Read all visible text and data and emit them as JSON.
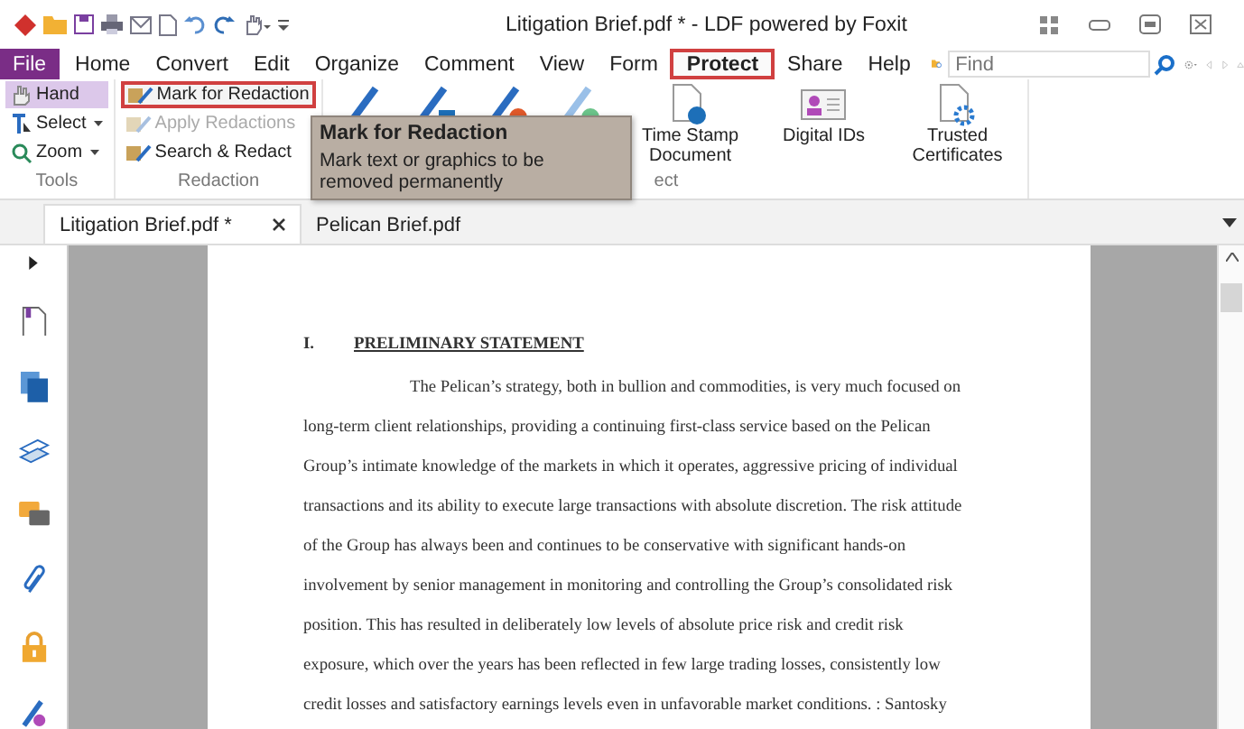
{
  "window": {
    "title": "Litigation Brief.pdf * - LDF powered by Foxit"
  },
  "menu": [
    {
      "label": "File",
      "kind": "file",
      "selected": false
    },
    {
      "label": "Home",
      "kind": "tab",
      "selected": false
    },
    {
      "label": "Convert",
      "kind": "tab",
      "selected": false
    },
    {
      "label": "Edit",
      "kind": "tab",
      "selected": false
    },
    {
      "label": "Organize",
      "kind": "tab",
      "selected": false
    },
    {
      "label": "Comment",
      "kind": "tab",
      "selected": false
    },
    {
      "label": "View",
      "kind": "tab",
      "selected": false
    },
    {
      "label": "Form",
      "kind": "tab",
      "selected": false
    },
    {
      "label": "Protect",
      "kind": "tab",
      "selected": true
    },
    {
      "label": "Share",
      "kind": "tab",
      "selected": false
    },
    {
      "label": "Help",
      "kind": "tab",
      "selected": false
    }
  ],
  "search": {
    "placeholder": "Find"
  },
  "ribbon": {
    "tools": {
      "label": "Tools",
      "items": [
        {
          "label": "Hand",
          "selected": true,
          "dropdown": false
        },
        {
          "label": "Select",
          "selected": false,
          "dropdown": true
        },
        {
          "label": "Zoom",
          "selected": false,
          "dropdown": true
        }
      ]
    },
    "redaction": {
      "label": "Redaction",
      "items": [
        {
          "label": "Mark for Redaction",
          "highlighted": true,
          "disabled": false
        },
        {
          "label": "Apply Redactions",
          "highlighted": false,
          "disabled": true
        },
        {
          "label": "Search & Redact",
          "highlighted": false,
          "disabled": false
        }
      ]
    },
    "protect_group_label": "ect",
    "large_buttons": [
      {
        "label": "Time Stamp Document"
      },
      {
        "label": "Digital IDs"
      },
      {
        "label": "Trusted Certificates"
      }
    ]
  },
  "tooltip": {
    "title": "Mark for Redaction",
    "text": "Mark text or graphics to be removed permanently"
  },
  "tabs": [
    {
      "label": "Litigation Brief.pdf *",
      "selected": true
    },
    {
      "label": "Pelican Brief.pdf",
      "selected": false
    }
  ],
  "document": {
    "number": "I.",
    "heading": "PRELIMINARY STATEMENT",
    "lines": [
      "The Pelican’s strategy, both in bullion and commodities, is very much focused on",
      "long-term client relationships, providing a continuing first-class service based on the Pelican",
      "Group’s intimate knowledge of the markets in which it operates, aggressive pricing of individual",
      "transactions and its ability to execute large transactions with absolute discretion. The risk attitude",
      "of the Group has always been and continues to be conservative with significant hands-on",
      "involvement by senior management in monitoring and controlling the Group’s consolidated risk",
      "position. This has resulted in deliberately low levels of absolute price risk and credit risk",
      "exposure, which over the years has been reflected in few large trading losses, consistently low",
      "credit losses and satisfactory earnings levels even in unfavorable market conditions. : Santosky"
    ]
  }
}
